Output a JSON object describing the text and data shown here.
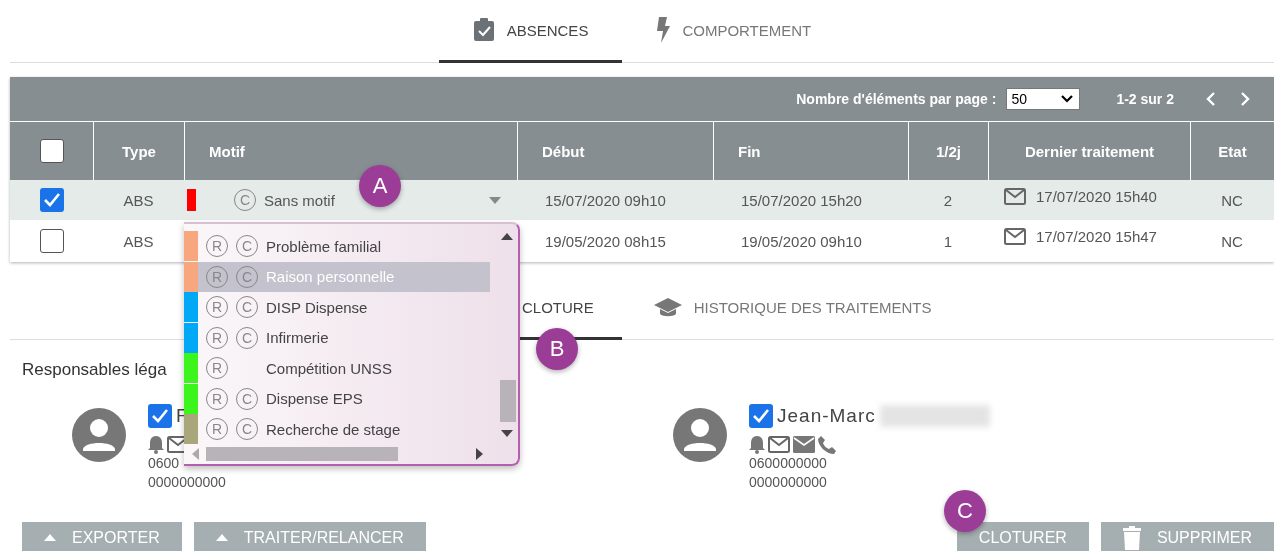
{
  "tabs": [
    {
      "label": "ABSENCES",
      "kind": "clipboard",
      "selected": true
    },
    {
      "label": "COMPORTEMENT",
      "kind": "bolt",
      "selected": false
    }
  ],
  "pagination": {
    "label": "Nombre d'éléments par page :",
    "page_size": "50",
    "range": "1-2 sur 2"
  },
  "table": {
    "select_all": {
      "checked": false
    },
    "columns": [
      "Type",
      "Motif",
      "Début",
      "Fin",
      "1/2j",
      "Dernier traitement",
      "Etat"
    ],
    "rows": [
      {
        "selected": true,
        "type": "ABS",
        "motif": {
          "label": "Sans motif",
          "color": "#ff0000",
          "c_tag": "C"
        },
        "debut": "15/07/2020 09h10",
        "fin": "15/07/2020 15h20",
        "demi_journees": "2",
        "dernier_traitement": "17/07/2020 15h40",
        "etat": "NC"
      },
      {
        "selected": false,
        "type": "ABS",
        "debut": "19/05/2020 08h15",
        "fin": "19/05/2020 09h10",
        "demi_journees": "1",
        "dernier_traitement": "17/07/2020 15h47",
        "etat": "NC"
      }
    ]
  },
  "motif_dropdown": {
    "items": [
      {
        "label": "Problème familial",
        "color": "#f8a67e",
        "r_tag": "R",
        "c_tag": "C",
        "selected": false
      },
      {
        "label": "Raison personnelle",
        "color": "#f8a67e",
        "r_tag": "R",
        "c_tag": "C",
        "selected": true
      },
      {
        "label": "DISP Dispense",
        "color": "#00a8f5",
        "r_tag": "R",
        "c_tag": "C",
        "selected": false
      },
      {
        "label": "Infirmerie",
        "color": "#00a8f5",
        "r_tag": "R",
        "c_tag": "C",
        "selected": false
      },
      {
        "label": "Compétition UNSS",
        "color": "#3cf51c",
        "r_tag": "R",
        "selected": false
      },
      {
        "label": "Dispense EPS",
        "color": "#3cf51c",
        "r_tag": "R",
        "c_tag": "C",
        "selected": false
      },
      {
        "label": "Recherche de stage",
        "color": "#a8a67a",
        "r_tag": "R",
        "c_tag": "C",
        "selected": false
      }
    ]
  },
  "detail_tabs": [
    {
      "label": "CLOTURE",
      "kind": "none",
      "selected": true
    },
    {
      "label": "HISTORIQUE DES TRAITEMENTS",
      "kind": "cap",
      "selected": false
    }
  ],
  "guardians": {
    "title": "Responsables léga",
    "people": [
      {
        "name": "F",
        "checked": true,
        "contacts": [
          {
            "kind": "bell"
          },
          {
            "kind": "mail"
          }
        ],
        "phones": [
          "0600",
          "0000000000"
        ]
      },
      {
        "name": "Jean-Marc",
        "checked": true,
        "name_redacted": true,
        "contacts": [
          {
            "kind": "bell"
          },
          {
            "kind": "mail"
          },
          {
            "kind": "mail_filled"
          },
          {
            "kind": "phone"
          }
        ],
        "phones": [
          "0600000000",
          "0000000000"
        ]
      }
    ]
  },
  "left_buttons": [
    {
      "label": "EXPORTER",
      "kind": "caret"
    },
    {
      "label": "TRAITER/RELANCER",
      "kind": "caret"
    }
  ],
  "right_buttons": [
    {
      "label": "CLOTURER",
      "kind": "none"
    },
    {
      "label": "SUPPRIMER",
      "kind": "trash"
    }
  ],
  "callouts": [
    "A",
    "B",
    "C"
  ]
}
